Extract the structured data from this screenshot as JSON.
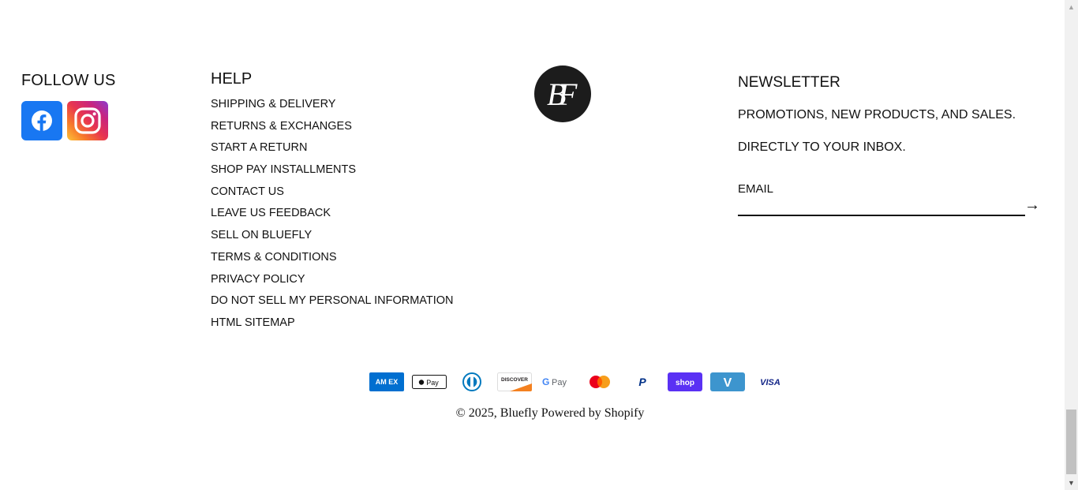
{
  "follow": {
    "title": "FOLLOW US",
    "icons": [
      "facebook-icon",
      "instagram-icon"
    ]
  },
  "help": {
    "title": "HELP",
    "links": [
      "SHIPPING & DELIVERY",
      "RETURNS & EXCHANGES",
      "START A RETURN",
      "SHOP PAY INSTALLMENTS",
      "CONTACT US",
      "LEAVE US FEEDBACK",
      "SELL ON BLUEFLY",
      "TERMS & CONDITIONS",
      "PRIVACY POLICY",
      "DO NOT SELL MY PERSONAL INFORMATION",
      "HTML SITEMAP"
    ]
  },
  "logo": {
    "monogram": "BF",
    "icon": "bluefly-logo"
  },
  "newsletter": {
    "title": "NEWSLETTER",
    "line1": "PROMOTIONS, NEW PRODUCTS, AND SALES.",
    "line2": "DIRECTLY TO YOUR INBOX.",
    "email_placeholder": "EMAIL",
    "submit_icon": "arrow-right-icon",
    "submit_glyph": "→"
  },
  "payments": {
    "amex": "AM EX",
    "applepay": "Pay",
    "discover": "DISCOVER",
    "gpay": "Pay",
    "paypal": "P",
    "shoppay": "shop",
    "venmo": "V",
    "visa": "VISA",
    "icons": [
      "amex-icon",
      "apple-pay-icon",
      "diners-club-icon",
      "discover-icon",
      "google-pay-icon",
      "mastercard-icon",
      "paypal-icon",
      "shop-pay-icon",
      "venmo-icon",
      "visa-icon"
    ]
  },
  "footer": {
    "copyright": "© 2025,",
    "brand": "Bluefly",
    "powered": "Powered by Shopify"
  },
  "colors": {
    "facebook": "#1877f2",
    "text": "#111111",
    "logo_bg": "#1c1c1c",
    "amex": "#016fd0",
    "shoppay": "#5a31f4",
    "venmo": "#3d95ce"
  }
}
